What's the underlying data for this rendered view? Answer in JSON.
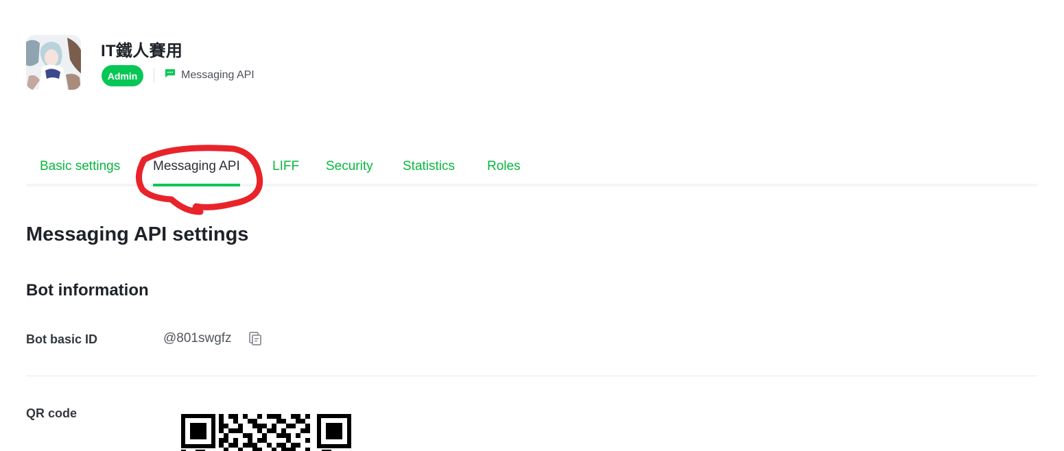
{
  "channel": {
    "name": "IT鐵人賽用",
    "role_badge": "Admin",
    "type_label": "Messaging API",
    "type_icon": "chat-bubble-icon"
  },
  "tabs": [
    {
      "label": "Basic settings",
      "active": false
    },
    {
      "label": "Messaging API",
      "active": true
    },
    {
      "label": "LIFF",
      "active": false
    },
    {
      "label": "Security",
      "active": false
    },
    {
      "label": "Statistics",
      "active": false
    },
    {
      "label": "Roles",
      "active": false
    }
  ],
  "content": {
    "title": "Messaging API settings",
    "bot_info_title": "Bot information",
    "bot_basic_id_label": "Bot basic ID",
    "bot_basic_id_value": "@801swgfz",
    "copy_icon": "copy-icon",
    "qr_label": "QR code"
  },
  "colors": {
    "brand_green": "#06c755",
    "tab_green": "#06b83e",
    "annotation_red": "#e8242a"
  }
}
